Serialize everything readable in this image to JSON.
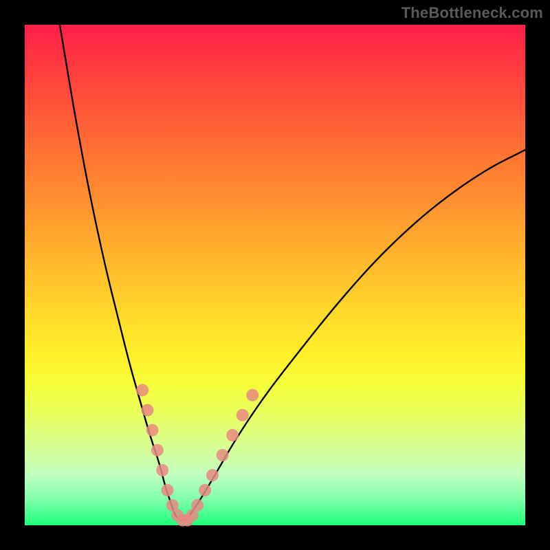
{
  "watermark": {
    "text": "TheBottleneck.com"
  },
  "chart_data": {
    "type": "line",
    "title": "",
    "xlabel": "",
    "ylabel": "",
    "xlim": [
      0,
      100
    ],
    "ylim": [
      0,
      100
    ],
    "grid": false,
    "legend_position": "none",
    "series": [
      {
        "name": "bottleneck-curve",
        "x": [
          7,
          10,
          13,
          16,
          19,
          21,
          23,
          25,
          27,
          28,
          29,
          30,
          31,
          32,
          33,
          35,
          38,
          42,
          48,
          55,
          63,
          72,
          82,
          92,
          100
        ],
        "y": [
          100,
          82,
          66,
          52,
          40,
          32,
          25,
          18,
          12,
          8,
          5,
          2,
          1,
          1,
          2,
          5,
          10,
          17,
          26,
          35,
          45,
          55,
          64,
          71,
          75
        ]
      }
    ],
    "markers": {
      "name": "highlight-dots",
      "color": "#e88a82",
      "points": [
        {
          "x": 23.5,
          "y": 27
        },
        {
          "x": 24.5,
          "y": 23
        },
        {
          "x": 25.5,
          "y": 19
        },
        {
          "x": 26.5,
          "y": 15
        },
        {
          "x": 27.5,
          "y": 11
        },
        {
          "x": 28.5,
          "y": 7
        },
        {
          "x": 29.5,
          "y": 4
        },
        {
          "x": 30.5,
          "y": 2
        },
        {
          "x": 31.5,
          "y": 1
        },
        {
          "x": 32.5,
          "y": 1
        },
        {
          "x": 33.5,
          "y": 2
        },
        {
          "x": 34.5,
          "y": 4
        },
        {
          "x": 36.0,
          "y": 7
        },
        {
          "x": 37.5,
          "y": 10
        },
        {
          "x": 39.5,
          "y": 14
        },
        {
          "x": 41.5,
          "y": 18
        },
        {
          "x": 43.5,
          "y": 22
        },
        {
          "x": 45.5,
          "y": 26
        }
      ]
    },
    "gradient_stops": [
      {
        "pos": 0.0,
        "color": "#ff1f4a"
      },
      {
        "pos": 0.5,
        "color": "#ffda2a"
      },
      {
        "pos": 0.95,
        "color": "#7fffaa"
      },
      {
        "pos": 1.0,
        "color": "#1aff7a"
      }
    ]
  }
}
